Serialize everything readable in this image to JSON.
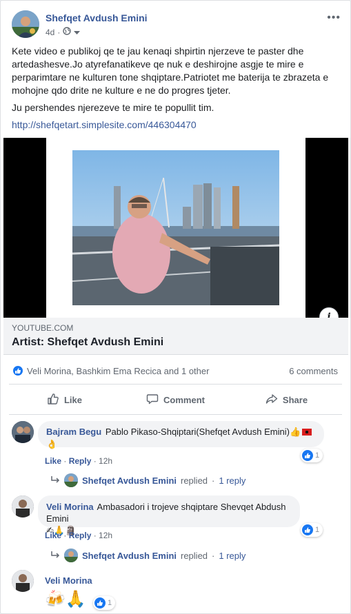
{
  "post": {
    "author": "Shefqet Avdush Emini",
    "time": "4d",
    "text_p1": "Kete video e publikoj qe te jau kenaqi shpirtin  njerzeve te paster dhe artedashesve.Jo    atyrefanatikeve qe nuk e deshirojne asgje te mire e perparimtare ne kulturen tone shqiptare.Patriotet me baterija te zbrazeta e mohojne qdo drite ne  kulture e ne do progres tjeter.",
    "text_p2": "Ju pershendes njerezeve te mire te popullit tim.",
    "link": "http://shefqetart.simplesite.com/446304470"
  },
  "link_preview": {
    "domain": "YOUTUBE.COM",
    "title": "Artist: Shefqet Avdush Emini"
  },
  "reactions": {
    "names": "Veli Morina, Bashkim Ema Recica and 1 other",
    "comments_count": "6 comments"
  },
  "actions": {
    "like": "Like",
    "comment": "Comment",
    "share": "Share"
  },
  "comments": [
    {
      "author": "Bajram Begu",
      "text": "Pablo Pikaso-Shqiptari(Shefqet Avdush Emini)",
      "emoji_tail": "👍",
      "emoji_line2": "👌",
      "like": "Like",
      "reply": "Reply",
      "time": "12h",
      "reaction_count": "1",
      "replies": {
        "author": "Shefqet Avdush Emini",
        "label": "replied",
        "count": "1 reply"
      }
    },
    {
      "author": "Veli Morina",
      "text": "Ambasadori i trojeve shqiptare Shevqet Abdush Emini",
      "emoji_line2": "✍🙏🗿",
      "like": "Like",
      "reply": "Reply",
      "time": "12h",
      "reaction_count": "1",
      "replies": {
        "author": "Shefqet Avdush Emini",
        "label": "replied",
        "count": "1 reply"
      }
    },
    {
      "author": "Veli Morina",
      "emojis": "🍻🙏",
      "reaction_count": "1"
    }
  ],
  "colors": {
    "link": "#385898",
    "accent": "#1877f2",
    "muted": "#606770"
  }
}
